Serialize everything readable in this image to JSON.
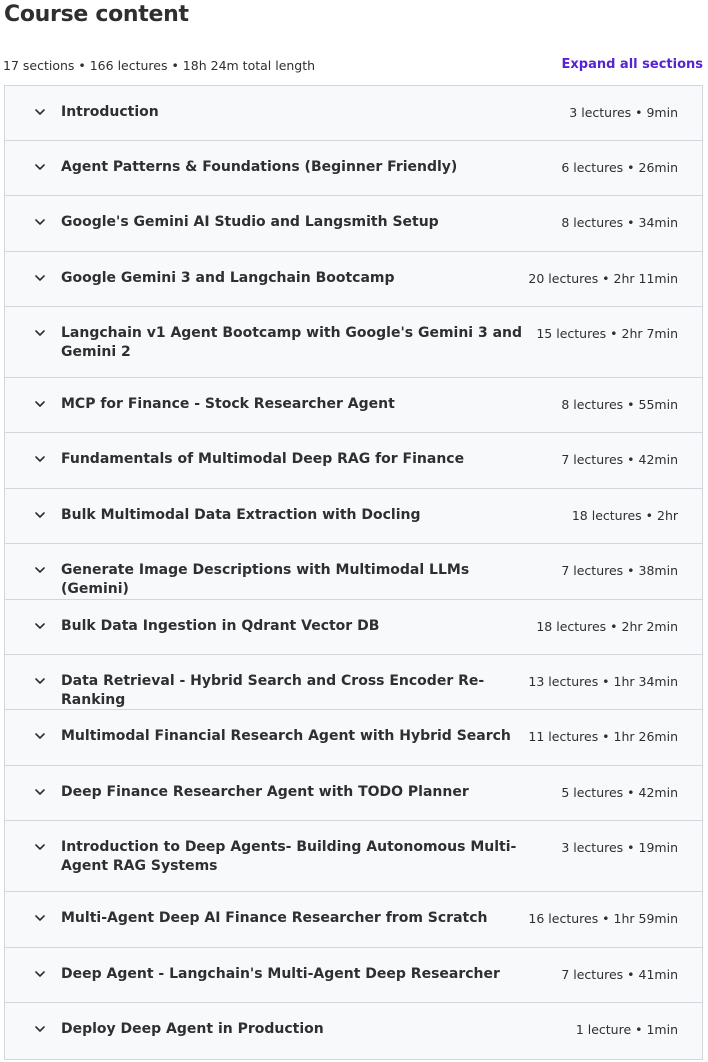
{
  "header": {
    "title": "Course content",
    "summary": "17 sections • 166 lectures • 18h 24m total length",
    "expand_all_label": "Expand all sections"
  },
  "icons": {
    "section_toggle": "chevron-down-icon"
  },
  "colors": {
    "accent": "#5624d0",
    "section_bg": "#f7f9fa",
    "border": "#d1d7dc",
    "text": "#2d2f31"
  },
  "sections": [
    {
      "title": "Introduction",
      "meta": "3 lectures • 9min"
    },
    {
      "title": "Agent Patterns & Foundations (Beginner Friendly)",
      "meta": "6 lectures • 26min"
    },
    {
      "title": "Google's Gemini AI Studio and Langsmith Setup",
      "meta": "8 lectures • 34min"
    },
    {
      "title": "Google Gemini 3 and Langchain Bootcamp",
      "meta": "20 lectures • 2hr 11min"
    },
    {
      "title": "Langchain v1 Agent Bootcamp with Google's Gemini 3 and Gemini 2",
      "meta": "15 lectures • 2hr 7min"
    },
    {
      "title": "MCP for Finance - Stock Researcher Agent",
      "meta": "8 lectures • 55min"
    },
    {
      "title": "Fundamentals of Multimodal Deep RAG for Finance",
      "meta": "7 lectures • 42min"
    },
    {
      "title": "Bulk Multimodal Data Extraction with Docling",
      "meta": "18 lectures • 2hr"
    },
    {
      "title": "Generate Image Descriptions with Multimodal LLMs (Gemini)",
      "meta": "7 lectures • 38min"
    },
    {
      "title": "Bulk Data Ingestion in Qdrant Vector DB",
      "meta": "18 lectures • 2hr 2min"
    },
    {
      "title": "Data Retrieval - Hybrid Search and Cross Encoder Re-Ranking",
      "meta": "13 lectures • 1hr 34min"
    },
    {
      "title": "Multimodal Financial Research Agent with Hybrid Search",
      "meta": "11 lectures • 1hr 26min"
    },
    {
      "title": "Deep Finance Researcher Agent with TODO Planner",
      "meta": "5 lectures • 42min"
    },
    {
      "title": "Introduction to Deep Agents- Building Autonomous Multi-Agent RAG Systems",
      "meta": "3 lectures • 19min"
    },
    {
      "title": "Multi-Agent Deep AI Finance Researcher from Scratch",
      "meta": "16 lectures • 1hr 59min"
    },
    {
      "title": "Deep Agent - Langchain's Multi-Agent Deep Researcher",
      "meta": "7 lectures • 41min"
    },
    {
      "title": "Deploy Deep Agent in Production",
      "meta": "1 lecture • 1min"
    }
  ]
}
